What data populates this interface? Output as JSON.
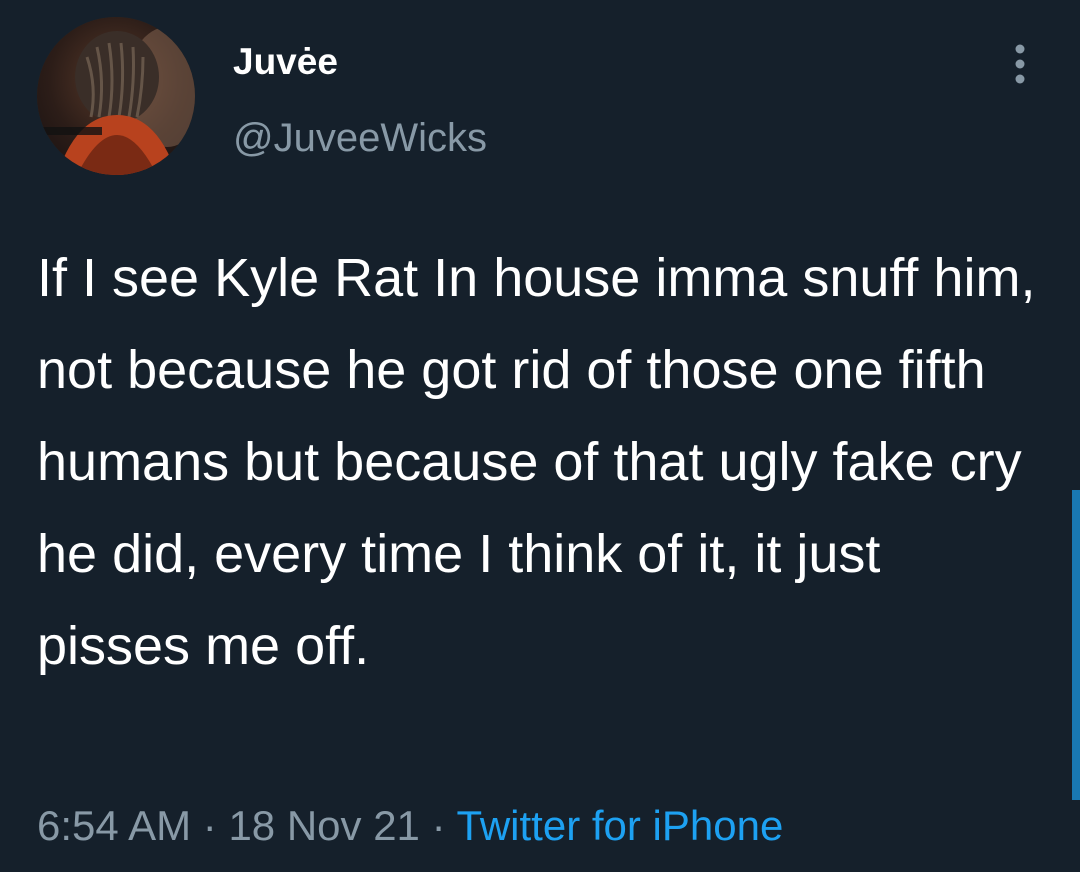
{
  "tweet": {
    "display_name": "Juvėe",
    "handle": "@JuveeWicks",
    "text": "If I see Kyle Rat In house imma snuff him, not because he got rid of those one fifth humans but because of that ugly fake cry he did, every time I think of it, it just pisses me off.",
    "time": "6:54 AM",
    "separator": "·",
    "date": "18 Nov 21",
    "source": "Twitter for iPhone"
  },
  "icons": {
    "more": "more-vertical-icon",
    "avatar": "user-avatar"
  },
  "colors": {
    "background": "#15202b",
    "primary_text": "#ffffff",
    "secondary_text": "#8899a6",
    "accent": "#1da1f2"
  }
}
